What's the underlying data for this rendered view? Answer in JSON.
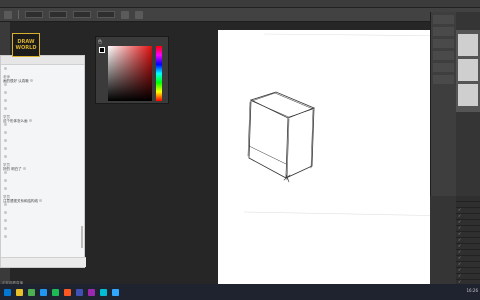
{
  "logo": {
    "line1": "DRAW",
    "line2": "WORLD"
  },
  "color_panel": {
    "tab": "色"
  },
  "chat": {
    "items": [
      {
        "name": "",
        "text": ""
      },
      {
        "name": "老师",
        "text": "画的很好 认真哦"
      },
      {
        "name": "",
        "text": ""
      },
      {
        "name": "",
        "text": ""
      },
      {
        "name": "",
        "text": ""
      },
      {
        "name": "",
        "text": ""
      },
      {
        "name": "学员",
        "text": "这个形体怎么画"
      },
      {
        "name": "",
        "text": ""
      },
      {
        "name": "",
        "text": ""
      },
      {
        "name": "",
        "text": ""
      },
      {
        "name": "",
        "text": ""
      },
      {
        "name": "",
        "text": ""
      },
      {
        "name": "学员",
        "text": "好的 明白了"
      },
      {
        "name": "",
        "text": ""
      },
      {
        "name": "",
        "text": ""
      },
      {
        "name": "",
        "text": ""
      },
      {
        "name": "学员",
        "text": "注意透视关系和结构线"
      },
      {
        "name": "",
        "text": ""
      },
      {
        "name": "",
        "text": ""
      },
      {
        "name": "",
        "text": ""
      },
      {
        "name": "",
        "text": ""
      },
      {
        "name": "",
        "text": ""
      }
    ],
    "status": "正在观看直播"
  },
  "taskbar": {
    "icons": [
      "#0078d4",
      "#e8c12a",
      "#4caf50",
      "#2196f3",
      "#1db954",
      "#ff5722",
      "#3f51b5",
      "#9c27b0",
      "#00bcd4",
      "#31a8ff"
    ]
  },
  "tray": {
    "time": "16:26"
  }
}
